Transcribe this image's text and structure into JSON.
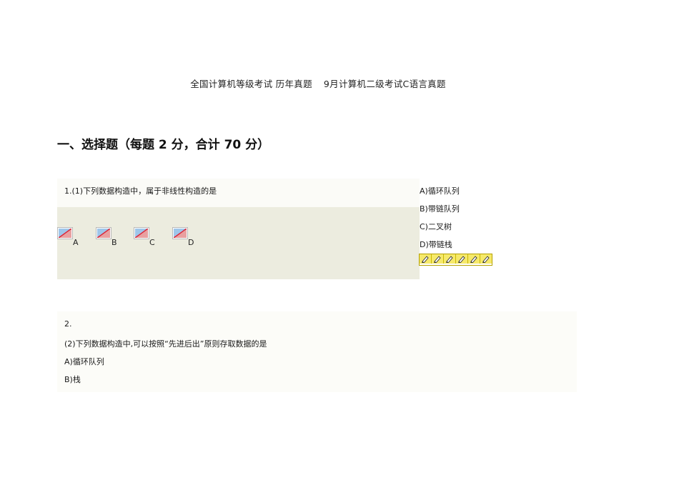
{
  "doc": {
    "title_left": "全国计算机等级考试 历年真题",
    "title_right": "9月计算机二级考试C语言真题"
  },
  "section": {
    "heading": "一、选择题（每题 2 分，合计 70 分）"
  },
  "q1": {
    "prompt": "1.(1)下列数据构造中，属于非线性构造的是",
    "image_choices": [
      "A",
      "B",
      "C",
      "D"
    ],
    "options": [
      "A)循环队列",
      "B)带链队列",
      "C)二叉树",
      "D)带链栈"
    ],
    "rating_icons": [
      "pencil-icon",
      "pencil-icon",
      "pencil-icon",
      "pencil-icon",
      "pencil-icon",
      "pencil-icon"
    ]
  },
  "q2": {
    "number": "2.",
    "prompt": "(2)下列数据构造中,可以按照“先进后出”原则存取数据的是",
    "options": [
      "A)循环队列",
      "B)栈"
    ]
  },
  "colors": {
    "q1_band": "#ececdf",
    "rating_fill": "#f6e96a"
  }
}
